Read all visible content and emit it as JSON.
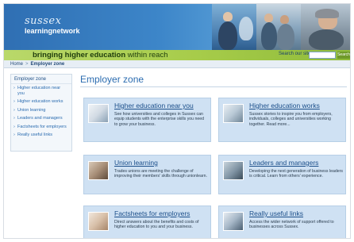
{
  "header": {
    "logo_top": "sussex",
    "logo_main": "learningnetwork",
    "tagline_bold": "bringing higher education",
    "tagline_rest": " within reach",
    "search_label": "Search our site",
    "search_button": "Search"
  },
  "breadcrumb": {
    "home": "Home",
    "separator": ">",
    "current": "Employer zone"
  },
  "sidebar": {
    "heading": "Employer zone",
    "items": [
      "Higher education near you",
      "Higher education works",
      "Union learning",
      "Leaders and managers",
      "Factsheets for employers",
      "Really useful links"
    ]
  },
  "main": {
    "title": "Employer zone",
    "cards": [
      {
        "title": "Higher education near you",
        "desc": "See how universities and colleges in Sussex can equip students with the enterprise skills you need to grow your business."
      },
      {
        "title": "Higher education works",
        "desc": "Sussex stories to inspire you from employers, individuals, colleges and universities working together. Read more..."
      },
      {
        "title": "Union learning",
        "desc": "Trades unions are meeting the challenge of improving their members' skills through unionlearn."
      },
      {
        "title": "Leaders and managers",
        "desc": "Developing the next generation of business leaders is critical. Learn from others' experience."
      },
      {
        "title": "Factsheets for employers",
        "desc": "Direct answers about the benefits and costs of higher education to you and your business."
      },
      {
        "title": "Really useful links",
        "desc": "Access the wider network of support offered to businesses across Sussex."
      }
    ]
  },
  "icons": {
    "card_1": "student-photo",
    "card_2": "people-photo",
    "card_3": "worker-photo",
    "card_4": "factory-photo",
    "card_5": "meeting-photo",
    "card_6": "chain-link-photo"
  },
  "colors": {
    "brand_blue": "#2f6fb3",
    "accent_green": "#a7cc4a",
    "card_bg": "#cfe1f3",
    "link_blue": "#1c4f8a"
  }
}
